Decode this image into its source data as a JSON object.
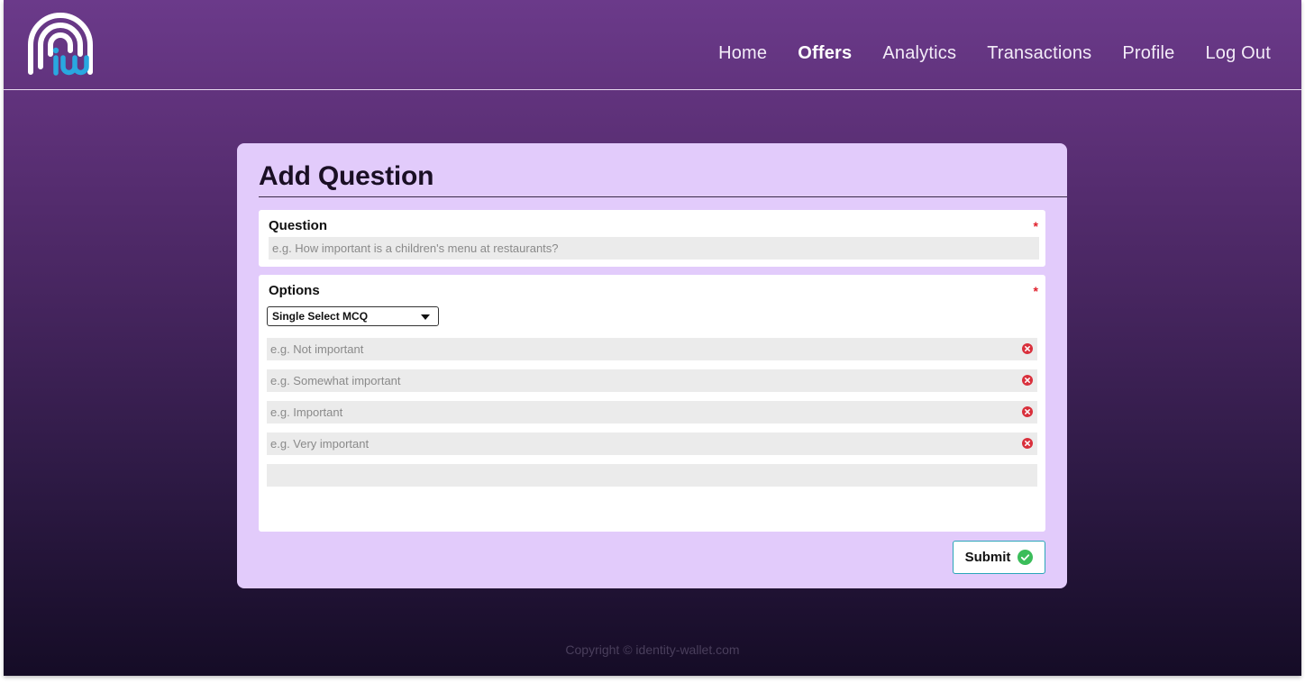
{
  "brand": {
    "logo_text": "iw",
    "logo_arc_color": "#ffffff",
    "logo_letter_color": "#29a8e0"
  },
  "nav": {
    "items": [
      {
        "label": "Home",
        "active": false
      },
      {
        "label": "Offers",
        "active": true
      },
      {
        "label": "Analytics",
        "active": false
      },
      {
        "label": "Transactions",
        "active": false
      },
      {
        "label": "Profile",
        "active": false
      },
      {
        "label": "Log Out",
        "active": false
      }
    ]
  },
  "form": {
    "title": "Add Question",
    "required_mark": "*",
    "question": {
      "label": "Question",
      "value": "",
      "placeholder": "e.g. How important is a children's menu at restaurants?"
    },
    "options": {
      "label": "Options",
      "type_selected": "Single Select MCQ",
      "items": [
        {
          "value": "",
          "placeholder": "e.g. Not important",
          "icon": "remove-icon"
        },
        {
          "value": "",
          "placeholder": "e.g. Somewhat important",
          "icon": "remove-icon"
        },
        {
          "value": "",
          "placeholder": "e.g. Important",
          "icon": "remove-icon"
        },
        {
          "value": "",
          "placeholder": "e.g. Very important",
          "icon": "remove-icon"
        },
        {
          "value": "",
          "placeholder": ""
        }
      ]
    },
    "submit": {
      "label": "Submit",
      "icon": "check-circle-icon"
    }
  },
  "footer": {
    "text": "Copyright © identity-wallet.com"
  },
  "colors": {
    "accent_purple": "#6b3a8a",
    "card_bg": "#e2cbfb",
    "required_red": "#e0202c",
    "remove_red": "#d9303c",
    "success_green": "#3bbd5a",
    "submit_border": "#2aa6b8"
  }
}
